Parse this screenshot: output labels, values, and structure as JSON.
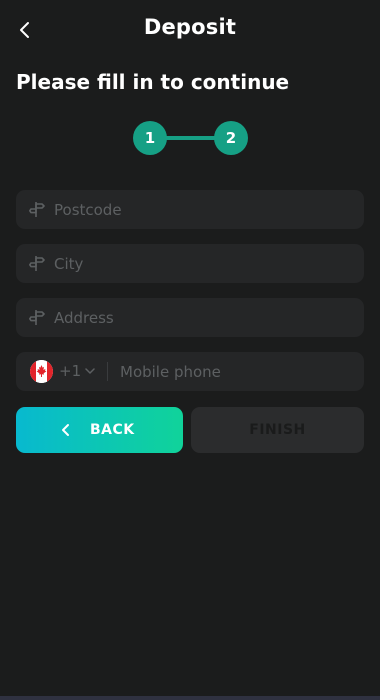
{
  "header": {
    "title": "Deposit"
  },
  "form": {
    "subtitle": "Please fill in to continue",
    "steps": [
      "1",
      "2"
    ],
    "current_step": 2,
    "postcode": {
      "placeholder": "Postcode",
      "value": ""
    },
    "city": {
      "placeholder": "City",
      "value": ""
    },
    "address": {
      "placeholder": "Address",
      "value": ""
    },
    "phone": {
      "country_flag": "flag-canada",
      "country_code": "+1",
      "placeholder": "Mobile phone",
      "value": ""
    }
  },
  "buttons": {
    "back_label": "BACK",
    "finish_label": "FINISH"
  },
  "colors": {
    "background": "#1b1c1c",
    "field": "#252627",
    "step_accent": "#16a085",
    "back_gradient_start": "#08b9cf",
    "back_gradient_end": "#10d39a",
    "finish_disabled": "#2b2c2d",
    "placeholder": "#5d6062"
  },
  "icons": {
    "back": "chevron-left-icon",
    "field": "signpost-icon",
    "dropdown": "chevron-down-icon"
  }
}
